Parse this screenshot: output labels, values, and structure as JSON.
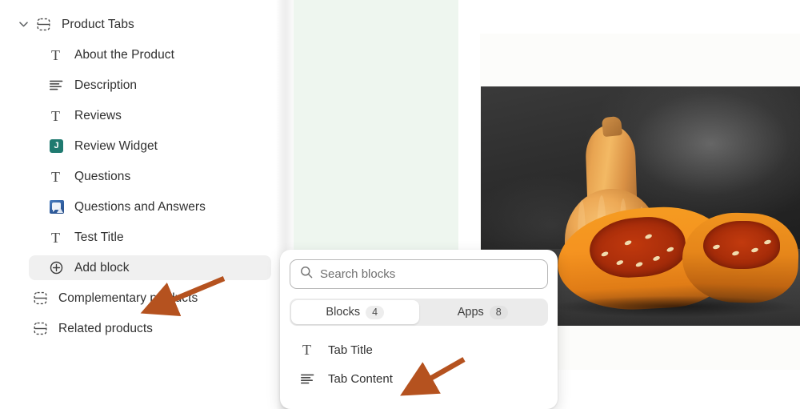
{
  "sidebar": {
    "items": [
      {
        "label": "Product Tabs",
        "icon": "section-block-icon",
        "level": 0,
        "expanded": true,
        "chevron": "chevron-down-icon"
      },
      {
        "label": "About the Product",
        "icon": "text-block-icon",
        "level": 1
      },
      {
        "label": "Description",
        "icon": "rich-text-icon",
        "level": 1
      },
      {
        "label": "Reviews",
        "icon": "text-block-icon",
        "level": 1
      },
      {
        "label": "Review Widget",
        "icon": "app-block-judgeme-icon",
        "level": 1,
        "badge_letter": "J"
      },
      {
        "label": "Questions",
        "icon": "text-block-icon",
        "level": 1
      },
      {
        "label": "Questions and Answers",
        "icon": "app-block-qa-icon",
        "level": 1
      },
      {
        "label": "Test Title",
        "icon": "text-block-icon",
        "level": 1
      },
      {
        "label": "Add block",
        "icon": "circle-plus-icon",
        "level": 1,
        "selected": true
      },
      {
        "label": "Complementary products",
        "icon": "section-block-icon",
        "level": 0
      },
      {
        "label": "Related products",
        "icon": "section-block-icon",
        "level": 0
      }
    ]
  },
  "picker": {
    "search": {
      "placeholder": "Search blocks",
      "value": "",
      "icon": "search-icon"
    },
    "tabs": [
      {
        "label": "Blocks",
        "count": "4",
        "active": true
      },
      {
        "label": "Apps",
        "count": "8",
        "active": false
      }
    ],
    "blocks": [
      {
        "label": "Tab Title",
        "icon": "text-block-icon"
      },
      {
        "label": "Tab Content",
        "icon": "rich-text-icon"
      }
    ]
  },
  "preview": {
    "product_image_alt": "Butternut squash whole and halved on dark background"
  },
  "annotations": [
    {
      "name": "arrow-to-add-block",
      "target": "Add block",
      "color": "#b5521f"
    },
    {
      "name": "arrow-to-tab-content",
      "target": "Tab Content",
      "color": "#b5521f"
    }
  ],
  "colors": {
    "accent_arrow": "#b5521f",
    "app_badge_teal": "#1f7a70",
    "app_badge_blue": "#2f5d9e",
    "selected_row_bg": "#f0f0f0",
    "canvas_green": "#eef6ef"
  }
}
